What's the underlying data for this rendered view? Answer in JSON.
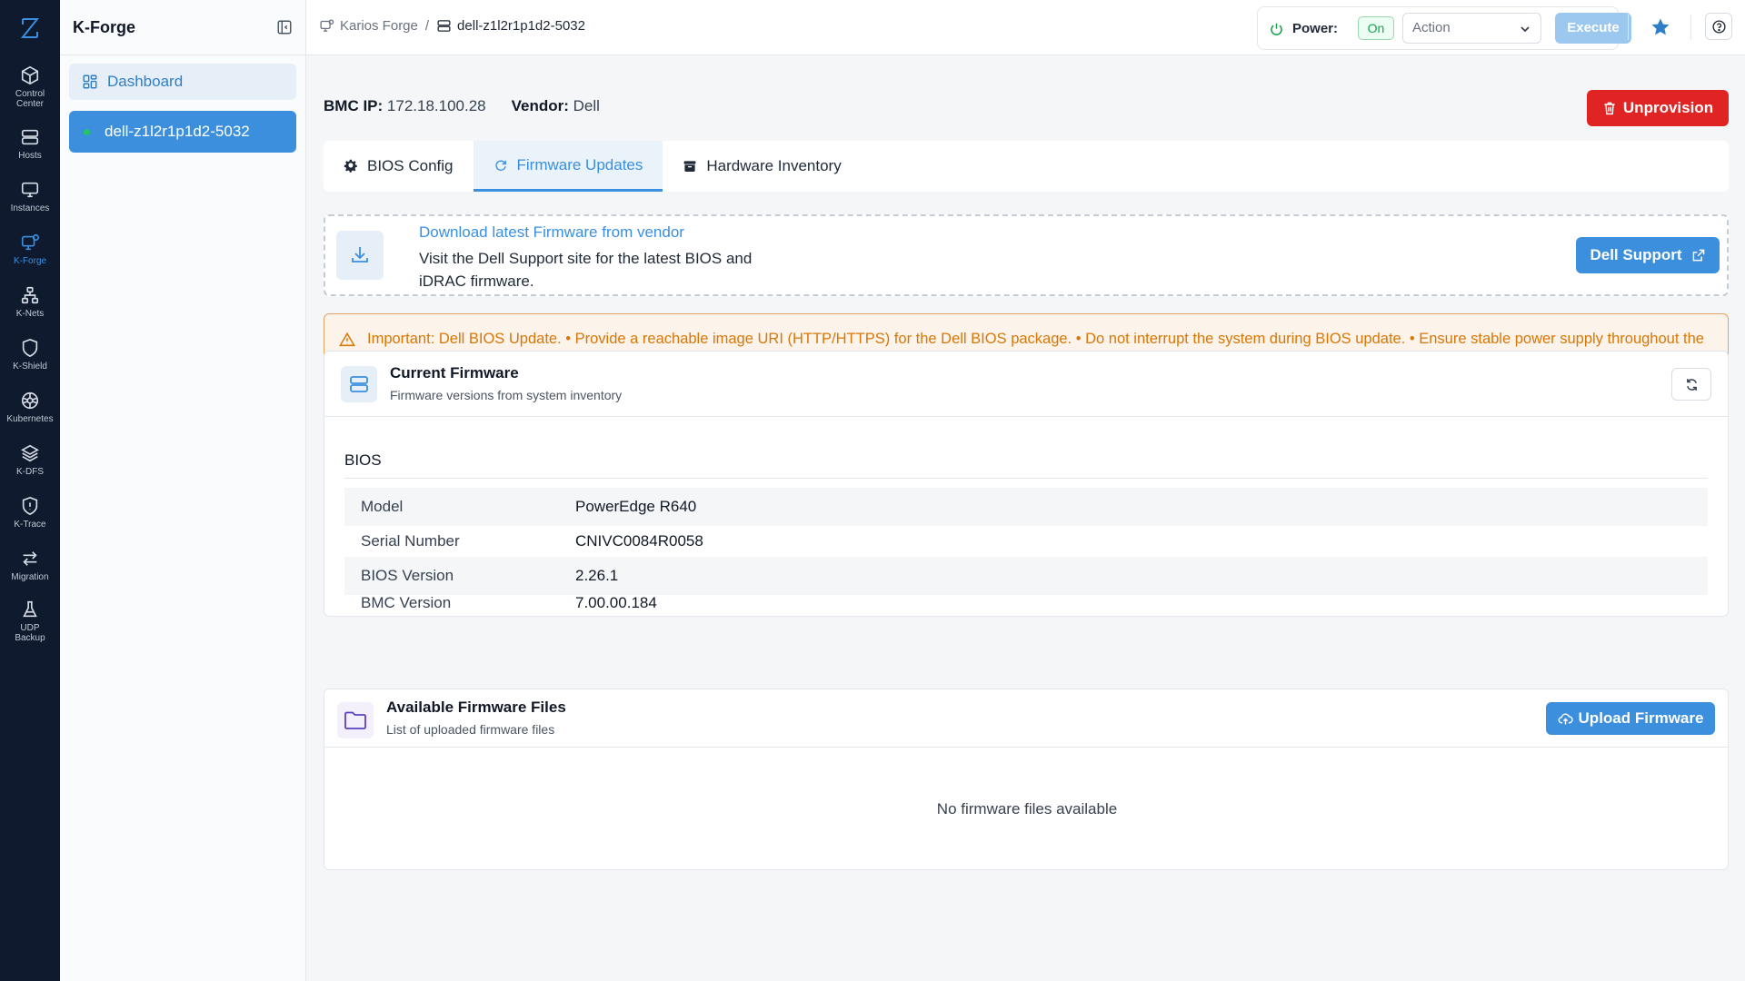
{
  "rail": {
    "items": [
      {
        "label": "Control\nCenter",
        "icon": "cube-icon"
      },
      {
        "label": "Hosts",
        "icon": "server-icon"
      },
      {
        "label": "Instances",
        "icon": "monitor-icon"
      },
      {
        "label": "K-Forge",
        "icon": "forge-icon",
        "active": true
      },
      {
        "label": "K-Nets",
        "icon": "network-icon"
      },
      {
        "label": "K-Shield",
        "icon": "shield-icon"
      },
      {
        "label": "Kubernetes",
        "icon": "kubernetes-icon"
      },
      {
        "label": "K-DFS",
        "icon": "layers-icon"
      },
      {
        "label": "K-Trace",
        "icon": "trace-icon"
      },
      {
        "label": "Migration",
        "icon": "arrows-icon"
      },
      {
        "label": "UDP\nBackup",
        "icon": "flask-icon"
      }
    ]
  },
  "panel": {
    "title": "K-Forge",
    "dashboard_label": "Dashboard",
    "host_label": "dell-z1l2r1p1d2-5032"
  },
  "topbar": {
    "breadcrumb_root": "Karios Forge",
    "breadcrumb_sep": "/",
    "breadcrumb_current": "dell-z1l2r1p1d2-5032",
    "power_label": "Power:",
    "power_state": "On",
    "action_placeholder": "Action",
    "execute_label": "Execute"
  },
  "info": {
    "bmc_label": "BMC IP:",
    "bmc_value": "172.18.100.28",
    "vendor_label": "Vendor:",
    "vendor_value": "Dell",
    "unprovision_label": "Unprovision"
  },
  "tabs": [
    {
      "label": "BIOS Config",
      "active": false
    },
    {
      "label": "Firmware Updates",
      "active": true
    },
    {
      "label": "Hardware Inventory",
      "active": false
    }
  ],
  "download": {
    "title": "Download latest Firmware from vendor",
    "desc": "Visit the Dell Support site for the latest BIOS and iDRAC firmware.",
    "button": "Dell Support"
  },
  "warning": {
    "text": "Important: Dell BIOS Update. • Provide a reachable image URI (HTTP/HTTPS) for the Dell BIOS package. • Do not interrupt the system during BIOS update. • Ensure stable power supply throughout the update process."
  },
  "current_firmware": {
    "title": "Current Firmware",
    "subtitle": "Firmware versions from system inventory",
    "section": "BIOS",
    "rows": [
      {
        "key": "Model",
        "value": "PowerEdge R640"
      },
      {
        "key": "Serial Number",
        "value": "CNIVC0084R0058"
      },
      {
        "key": "BIOS Version",
        "value": "2.26.1"
      },
      {
        "key": "BMC Version",
        "value": "7.00.00.184"
      }
    ]
  },
  "available_files": {
    "title": "Available Firmware Files",
    "subtitle": "List of uploaded firmware files",
    "upload_label": "Upload Firmware",
    "empty_text": "No firmware files available"
  },
  "colors": {
    "accent": "#3b8fdc",
    "danger": "#e02424",
    "warning": "#d97706",
    "rail_bg": "#0f1a2e",
    "success": "#16a34a"
  }
}
